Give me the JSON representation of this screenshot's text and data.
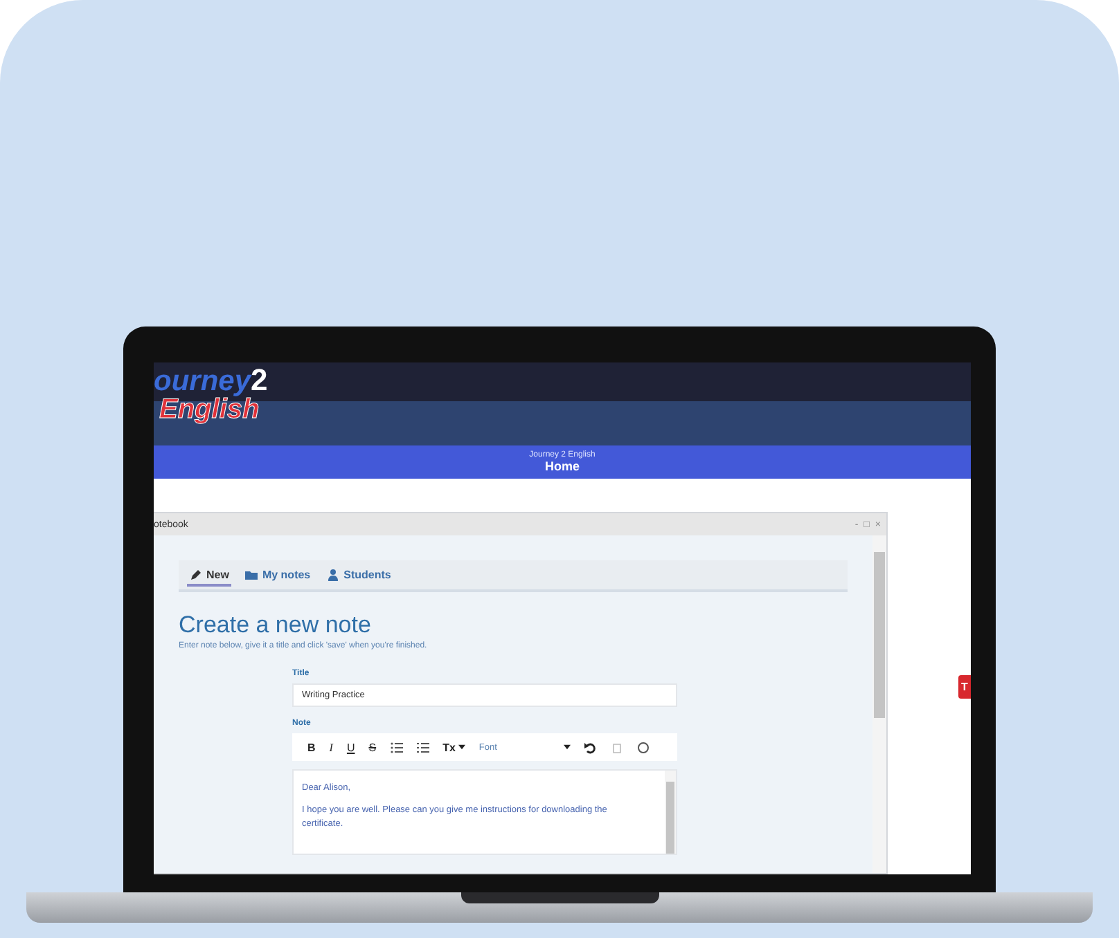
{
  "logo": {
    "line_1": "ourney",
    "digit": "2",
    "line_2": "English"
  },
  "banner": {
    "subtitle": "Journey 2 English",
    "title": "Home"
  },
  "side_tab": {
    "label": "T"
  },
  "window": {
    "title": "otebook",
    "controls": [
      "-",
      "□",
      "×"
    ]
  },
  "tabs": [
    {
      "label": "New",
      "selected": true
    },
    {
      "label": "My notes",
      "selected": false
    },
    {
      "label": "Students",
      "selected": false
    }
  ],
  "heading": "Create a new note",
  "intro": "Enter note below, give it a title and click 'save' when you're finished.",
  "title_field": {
    "label": "Title",
    "value": "Writing Practice"
  },
  "note_field": {
    "label": "Note"
  },
  "toolbar": [
    {
      "kind": "bold",
      "label": "B"
    },
    {
      "kind": "italic",
      "label": "I"
    },
    {
      "kind": "underline",
      "label": "U"
    },
    {
      "kind": "strike",
      "label": "S"
    },
    {
      "kind": "bullets"
    },
    {
      "kind": "numbers"
    },
    {
      "kind": "clear",
      "label": "Tx"
    },
    {
      "kind": "select",
      "label": "Font"
    },
    {
      "kind": "undo"
    },
    {
      "kind": "redo"
    },
    {
      "kind": "circle"
    }
  ],
  "note_body": [
    "Dear Alison,",
    "I hope you are well. Please can you give me instructions for downloading the certificate."
  ]
}
